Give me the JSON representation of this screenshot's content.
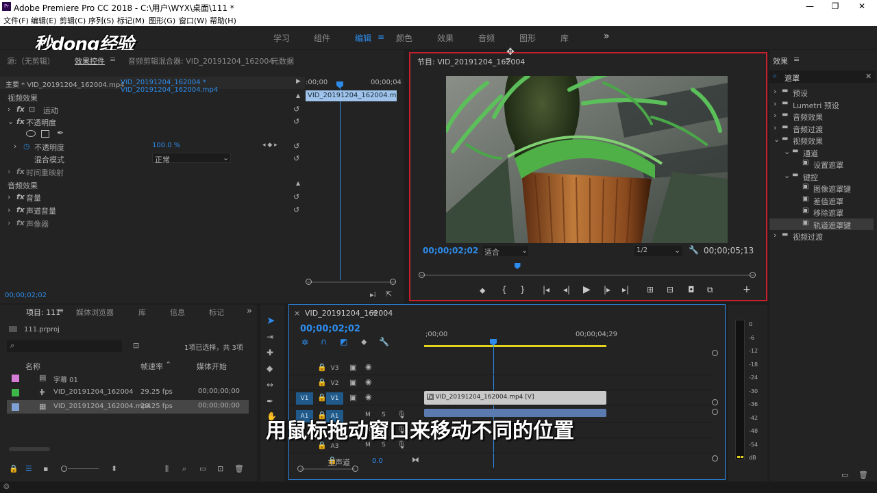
{
  "window": {
    "title": "Adobe Premiere Pro CC 2018 - C:\\用户\\WYX\\桌面\\111 *",
    "app_icon": "Pr",
    "minimize": "—",
    "maximize": "❐",
    "close": "✕"
  },
  "menu": [
    "文件(F)",
    "编辑(E)",
    "剪辑(C)",
    "序列(S)",
    "标记(M)",
    "图形(G)",
    "窗口(W)",
    "帮助(H)"
  ],
  "watermark": "秒dong经验",
  "workspaces": {
    "items": [
      "学习",
      "组件",
      "编辑",
      "颜色",
      "效果",
      "音频",
      "图形",
      "库"
    ],
    "active": "编辑",
    "more": "»",
    "menu_icon": "≡"
  },
  "effect_controls": {
    "tabs": [
      "源:（无剪辑）",
      "效果控件",
      "音频剪辑混合器: VID_20191204_162004",
      "元数据"
    ],
    "master": "主要 * VID_20191204_162004.mp4",
    "sequence_clip": "VID_20191204_162004 * VID_20191204_162004.mp4",
    "ruler_start": ":00;00",
    "ruler_end": "00;00;04",
    "clip_label": "VID_20191204_162004.mp4",
    "video_header": "视频效果",
    "motion": "运动",
    "opacity": "不透明度",
    "opacity_param": "不透明度",
    "opacity_value": "100.0 %",
    "blend_mode_label": "混合模式",
    "blend_mode_value": "正常",
    "time_remap": "时间重映射",
    "audio_header": "音频效果",
    "volume": "音量",
    "channel_volume": "声道音量",
    "panner": "声像器",
    "fx": "fx",
    "timecode": "00;00;02;02"
  },
  "program": {
    "title": "节目: VID_20191204_162004",
    "timecode": "00;00;02;02",
    "fit": "适合",
    "resolution": "1/2",
    "duration": "00;00;05;13",
    "border_color": "#c8202a",
    "playhead_pct": 29
  },
  "effects": {
    "title": "效果",
    "search": "遮罩",
    "tree": [
      {
        "label": "预设",
        "level": 0,
        "type": "folder"
      },
      {
        "label": "Lumetri 预设",
        "level": 0,
        "type": "folder"
      },
      {
        "label": "音频效果",
        "level": 0,
        "type": "folder"
      },
      {
        "label": "音频过渡",
        "level": 0,
        "type": "folder"
      },
      {
        "label": "视频效果",
        "level": 0,
        "type": "folder-open"
      },
      {
        "label": "通道",
        "level": 1,
        "type": "folder-open"
      },
      {
        "label": "设置遮罩",
        "level": 2,
        "type": "effect"
      },
      {
        "label": "键控",
        "level": 1,
        "type": "folder-open"
      },
      {
        "label": "图像遮罩键",
        "level": 2,
        "type": "effect"
      },
      {
        "label": "差值遮罩",
        "level": 2,
        "type": "effect"
      },
      {
        "label": "移除遮罩",
        "level": 2,
        "type": "effect"
      },
      {
        "label": "轨道遮罩键",
        "level": 2,
        "type": "effect",
        "selected": true
      },
      {
        "label": "视频过渡",
        "level": 0,
        "type": "folder"
      }
    ]
  },
  "project": {
    "tabs": [
      "项目: 111",
      "媒体浏览器",
      "库",
      "信息",
      "标记"
    ],
    "file": "111.prproj",
    "selection": "1项已选择，共 3项",
    "columns": [
      "名称",
      "帧速率",
      "媒体开始"
    ],
    "items": [
      {
        "color": "#d67bd6",
        "name": "字幕 01",
        "fps": "",
        "start": ""
      },
      {
        "color": "#3fb84a",
        "name": "VID_20191204_162004",
        "fps": "29.25 fps",
        "start": "00;00;00;00"
      },
      {
        "color": "#7fa0d4",
        "name": "VID_20191204_162004.mp4",
        "fps": "29.25 fps",
        "start": "00;00;00;00",
        "selected": true
      }
    ]
  },
  "timeline": {
    "title": "VID_20191204_162004",
    "timecode": "00;00;02;02",
    "ruler_start": ";00;00",
    "ruler_end": "00;00;04;29",
    "tracks": [
      {
        "name": "V3",
        "source": ""
      },
      {
        "name": "V2",
        "source": ""
      },
      {
        "name": "V1",
        "source": "V1"
      },
      {
        "name": "A1",
        "source": "A1"
      },
      {
        "name": "A2",
        "source": ""
      },
      {
        "name": "A3",
        "source": ""
      }
    ],
    "master_label": "主声道",
    "master_value": "0.0",
    "clip_v1": "VID_20191204_162004.mp4 [V]",
    "track_buttons": {
      "mute": "M",
      "solo": "S"
    }
  },
  "audio_meter": {
    "labels": [
      "0",
      "-6",
      "-12",
      "-18",
      "-24",
      "-30",
      "-36",
      "-42",
      "-48",
      "-54",
      "dB"
    ]
  },
  "subtitle": "用鼠标拖动窗口来移动不同的位置"
}
